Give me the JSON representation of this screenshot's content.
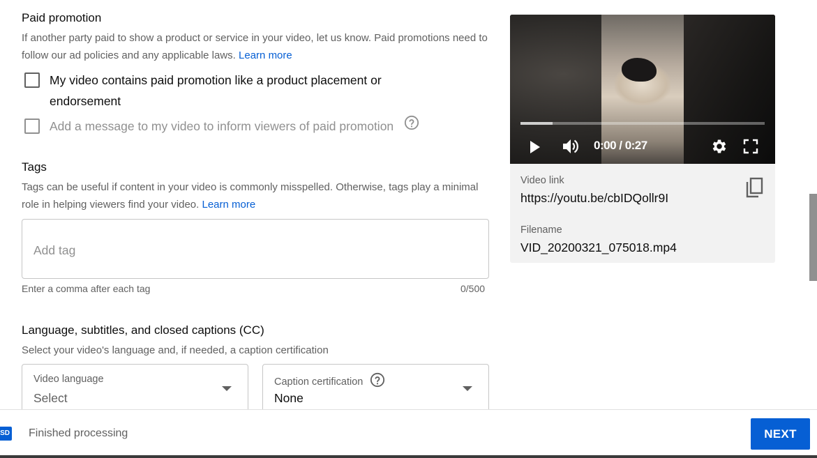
{
  "paid_promotion": {
    "title": "Paid promotion",
    "description": "If another party paid to show a product or service in your video, let us know. Paid promotions need to follow our ad policies and any applicable laws.",
    "learn_more": "Learn more",
    "checkbox_1_line1": "My video contains paid promotion like a product placement or",
    "checkbox_1_line2": "endorsement",
    "checkbox_2": "Add a message to my video to inform viewers of paid promotion"
  },
  "tags": {
    "title": "Tags",
    "description": "Tags can be useful if content in your video is commonly misspelled. Otherwise, tags play a minimal role in helping viewers find your video.",
    "learn_more": "Learn more",
    "placeholder": "Add tag",
    "hint": "Enter a comma after each tag",
    "counter": "0/500"
  },
  "language": {
    "title": "Language, subtitles, and closed captions (CC)",
    "description": "Select your video's language and, if needed, a caption certification",
    "video_language_label": "Video language",
    "video_language_value": "Select",
    "caption_label": "Caption certification",
    "caption_value": "None"
  },
  "video": {
    "time": "0:00 / 0:27",
    "progress_loaded": 0.13,
    "link_label": "Video link",
    "link_value": "https://youtu.be/cbIDQollr9I",
    "filename_label": "Filename",
    "filename_value": "VID_20200321_075018.mp4"
  },
  "footer": {
    "badge": "SD",
    "status": "Finished processing",
    "next_label": "NEXT"
  },
  "colors": {
    "accent": "#065fd4",
    "text_secondary": "#606060"
  },
  "icons": [
    "help-icon",
    "play-icon",
    "volume-icon",
    "settings-gear-icon",
    "fullscreen-icon",
    "copy-icon",
    "dropdown-arrow-icon"
  ]
}
